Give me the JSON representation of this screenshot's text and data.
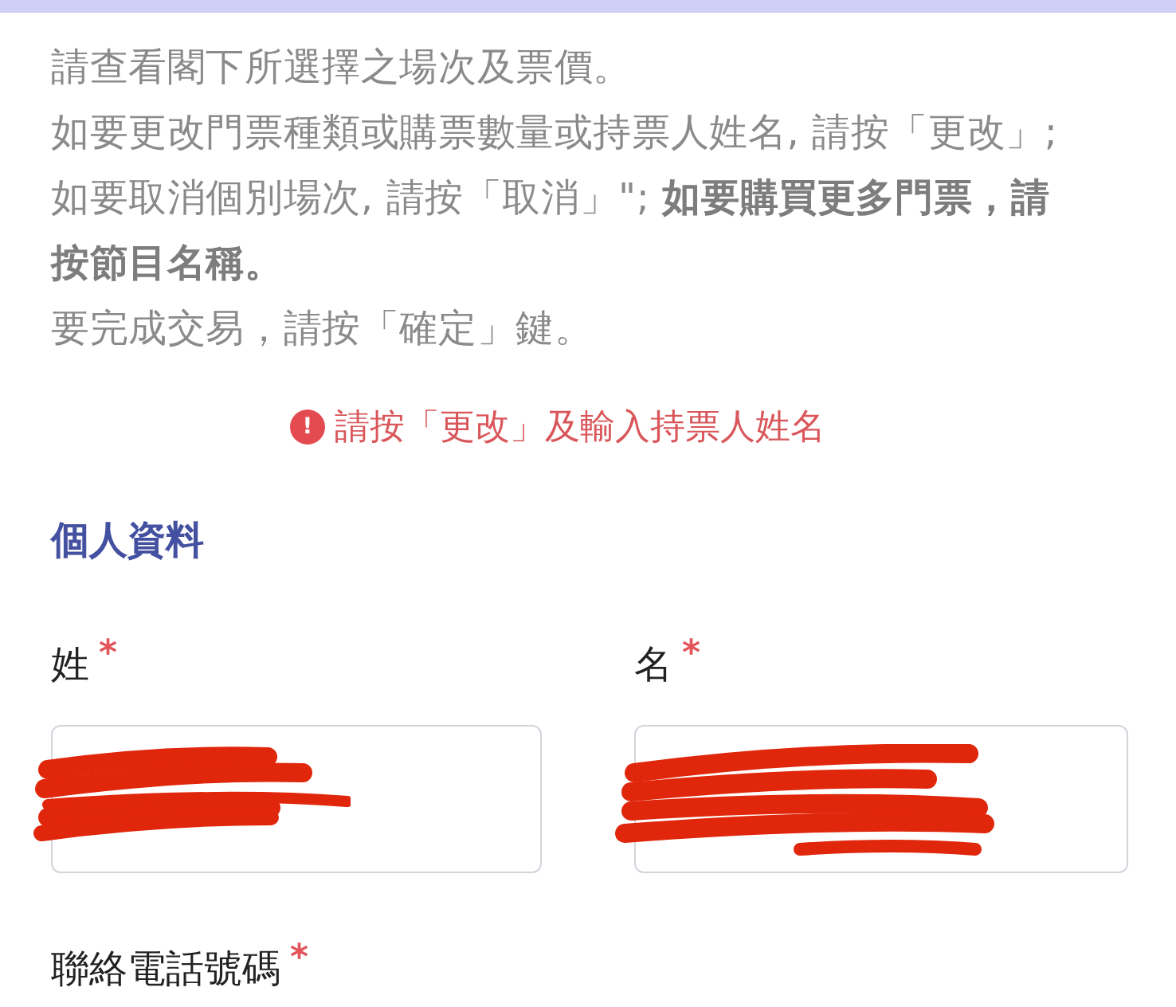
{
  "instructions": [
    "請查看閣下所選擇之場次及票價。",
    "如要更改門票種類或購票數量或持票人姓名, 請按「更改」; 如要取消個別場次, 請按「取消」\"; **如要購買更多門票，請按節目名稱。**",
    "要完成交易，請按「確定」鍵。"
  ],
  "error": {
    "icon": "!",
    "message": "請按「更改」及輸入持票人姓名"
  },
  "section_title": "個人資料",
  "name_fields": [
    {
      "label": "姓",
      "required_mark": "*",
      "redacted": true
    },
    {
      "label": "名",
      "required_mark": "*",
      "redacted": true
    }
  ],
  "phone_field": {
    "label": "聯絡電話號碼",
    "required_mark": "*"
  }
}
